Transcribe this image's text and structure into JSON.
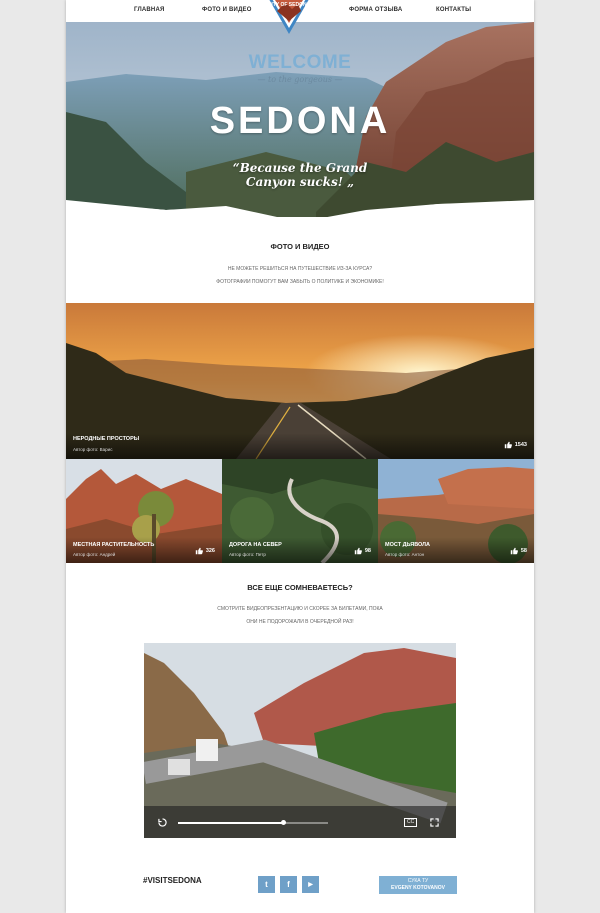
{
  "nav": {
    "items": [
      "ГЛАВНАЯ",
      "ФОТО И ВИДЕО",
      "ФОРМА ОТЗЫВА",
      "КОНТАКТЫ"
    ],
    "badge_text": "CITY OF SEDONA"
  },
  "hero": {
    "welcome": "WELCOME",
    "tagline": "— to the gorgeous —",
    "title": "SEDONA",
    "quote_line1": "“Because the Grand",
    "quote_line2": "Canyon sucks! „"
  },
  "photos_section": {
    "title": "ФОТО И ВИДЕО",
    "text_line1": "НЕ МОЖЕТЕ РЕШИТЬСЯ НА ПУТЕШЕСТВИЕ ИЗ-ЗА КУРСА?",
    "text_line2": "ФОТОГРАФИИ ПОМОГУТ ВАМ ЗАБЫТЬ О ПОЛИТИКЕ И ЭКОНОМИКЕ!"
  },
  "photos": [
    {
      "caption": "НЕРОДНЫЕ ПРОСТОРЫ",
      "author": "Автор фото: Варис",
      "likes": "1543"
    },
    {
      "caption": "МЕСТНАЯ РАСТИТЕЛЬНОСТЬ",
      "author": "Автор фото: Андрей",
      "likes": "326"
    },
    {
      "caption": "ДОРОГА НА СЕВЕР",
      "author": "Автор фото: Петр",
      "likes": "98"
    },
    {
      "caption": "МОСТ ДЬЯВОЛА",
      "author": "Автор фото: Антон",
      "likes": "58"
    }
  ],
  "video_section": {
    "title": "ВСЕ ЕЩЕ СОМНЕВАЕТЕСЬ?",
    "text_line1": "СМОТРИТЕ ВИДЕОПРЕЗЕНТАЦИЮ И СКОРЕЕ ЗА БИЛЕТАМИ, ПОКА",
    "text_line2": "ОНИ НЕ ПОДОРОЖАЛИ В ОЧЕРЕДНОЙ РАЗ!",
    "cc_label": "CC",
    "progress": 0.7
  },
  "footer": {
    "hashtag": "#VISITSEDONA",
    "social": [
      "t",
      "f",
      "▶"
    ],
    "credit_line1": "СУКА ТУ",
    "credit_line2": "EVGENY KOTOVANOV"
  },
  "colors": {
    "accent": "#7fb0d4",
    "social": "#6fa0c8"
  }
}
